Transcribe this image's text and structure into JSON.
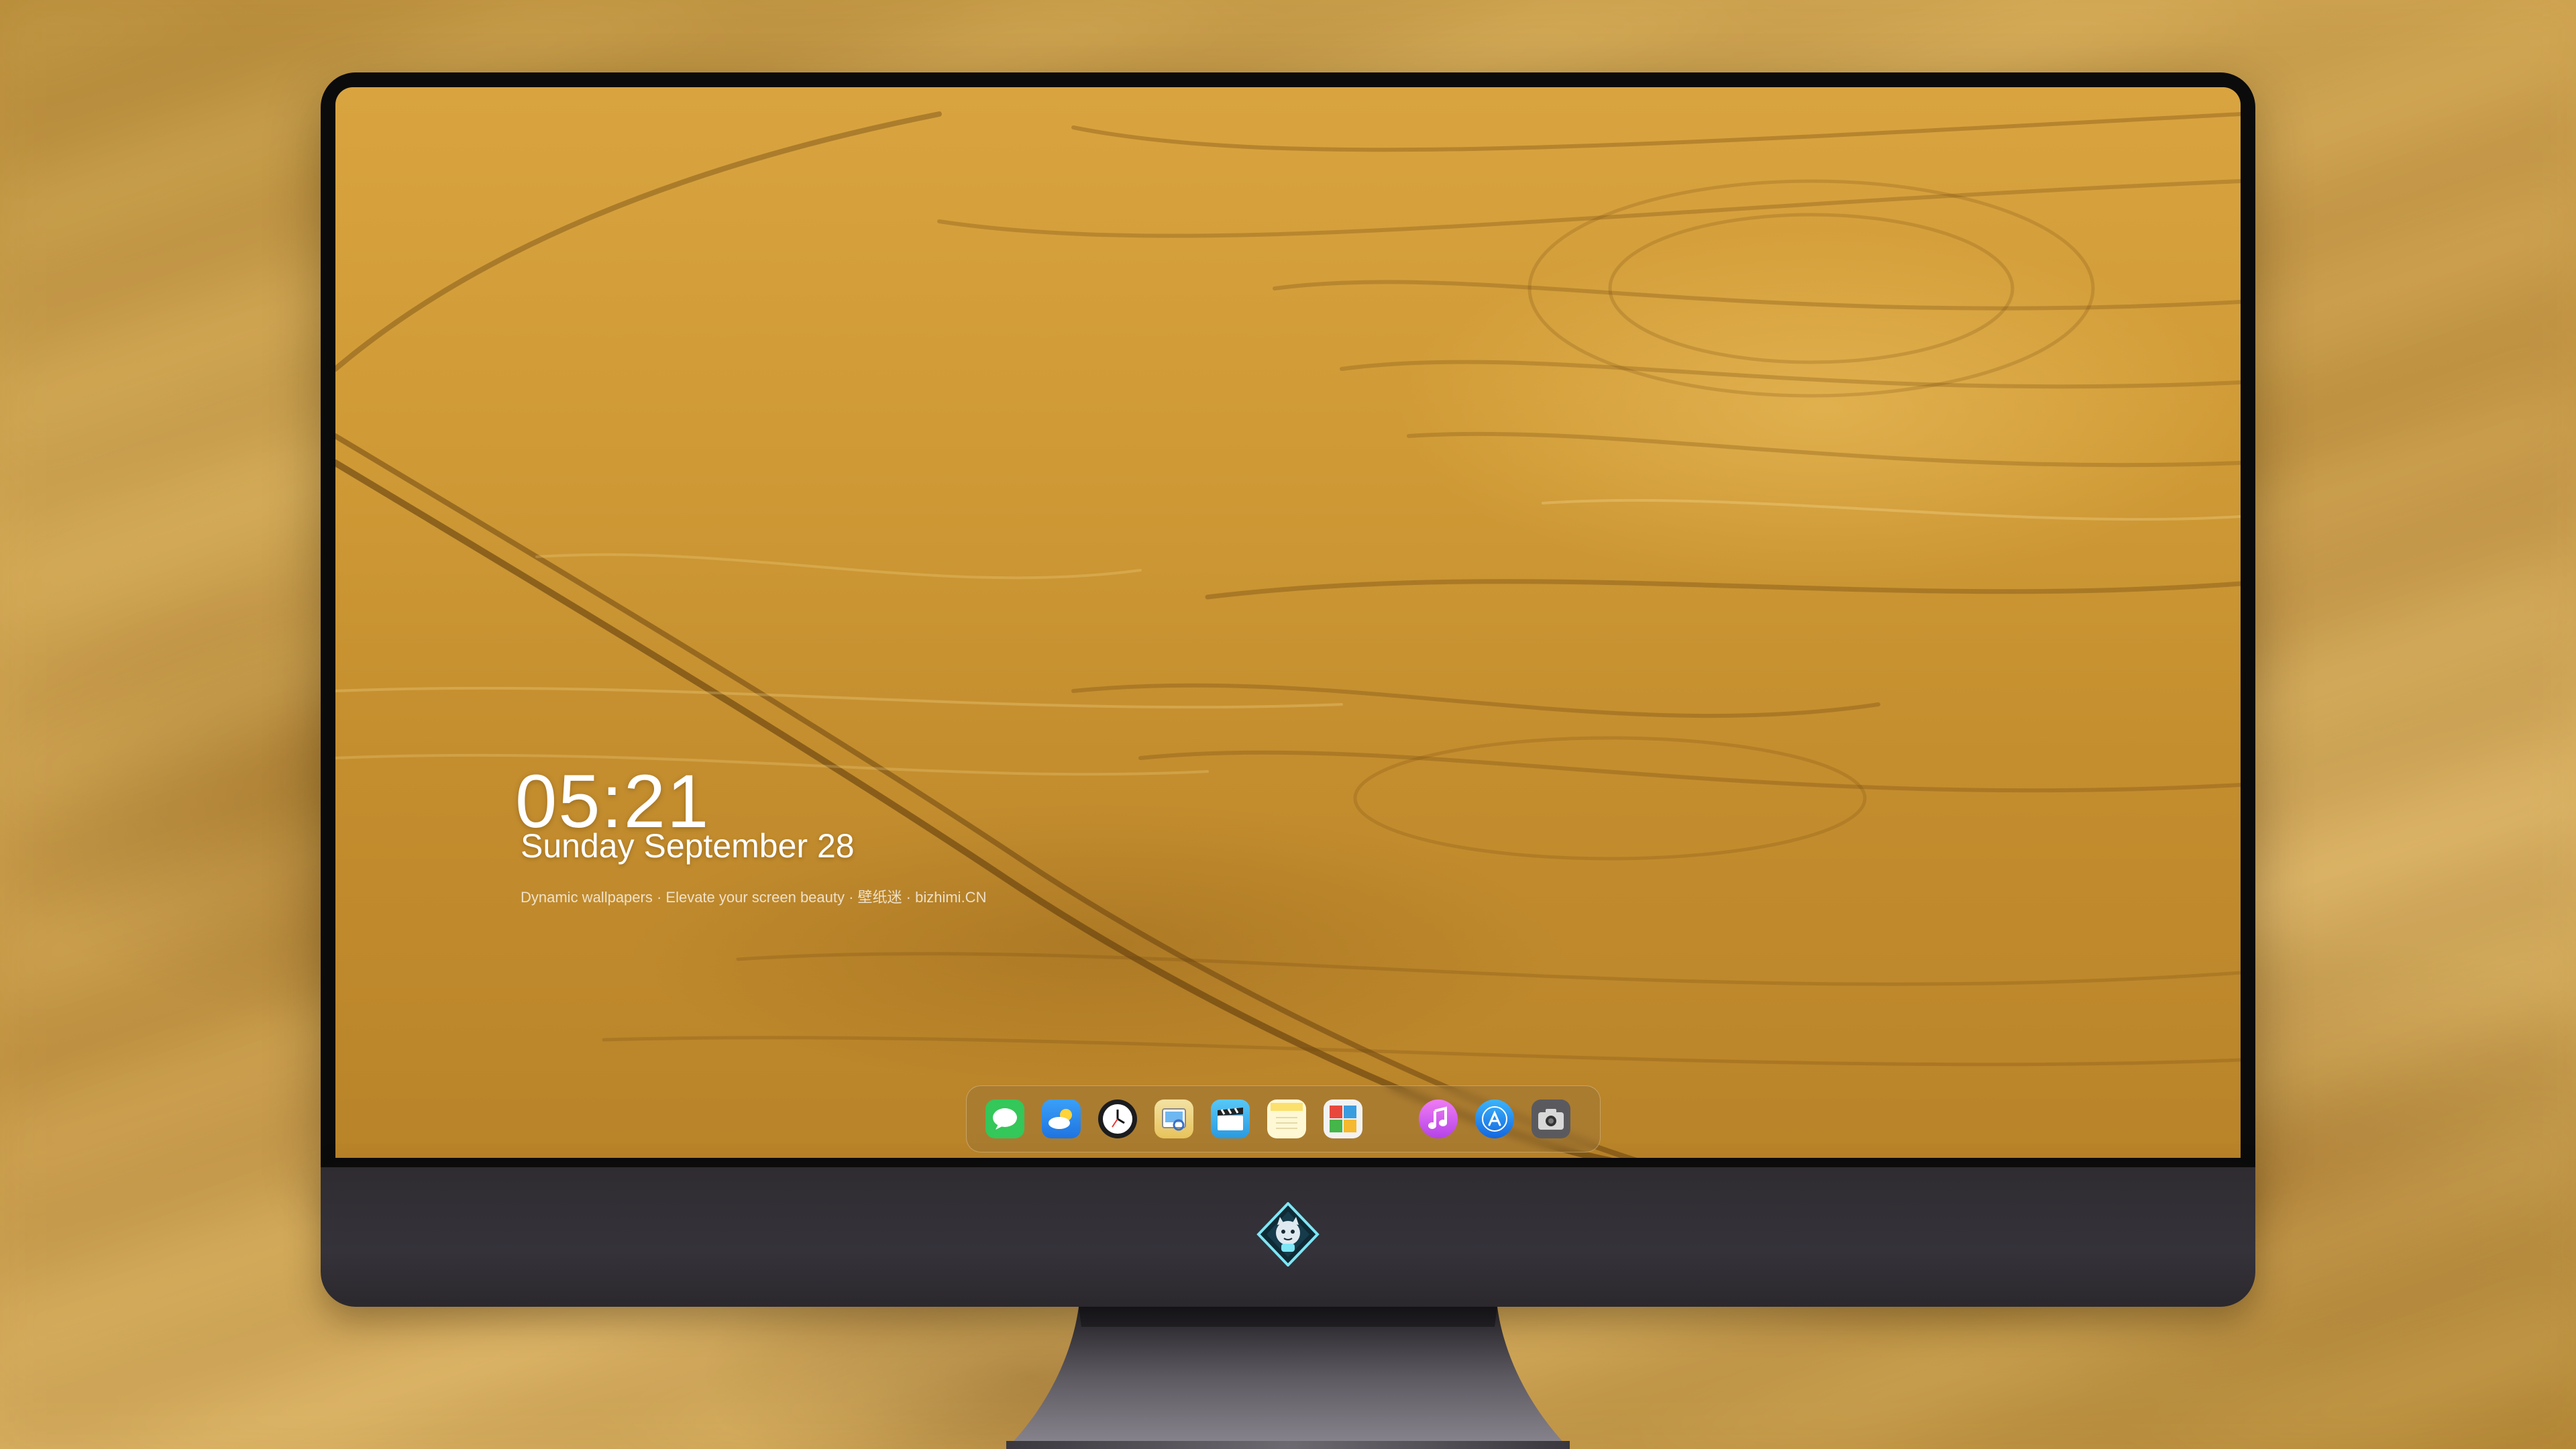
{
  "lock_screen": {
    "time": "05:21",
    "date": "Sunday September  28",
    "caption": "Dynamic wallpapers · Elevate your screen beauty · 壁纸迷 · bizhimi.CN"
  },
  "dock": {
    "items": [
      {
        "name": "Messages",
        "icon": "messages-icon",
        "color": "#34c759"
      },
      {
        "name": "Weather",
        "icon": "weather-icon",
        "color": "#2a8cf0"
      },
      {
        "name": "Clock",
        "icon": "clock-icon",
        "color": "#1c1c1e"
      },
      {
        "name": "Preview",
        "icon": "preview-icon",
        "color": "#e7c35a"
      },
      {
        "name": "Clips",
        "icon": "clapperboard-icon",
        "color": "#3ab0f0"
      },
      {
        "name": "Notes",
        "icon": "notes-icon",
        "color": "#fbe06d"
      },
      {
        "name": "Photo Booth",
        "icon": "photo-booth-icon",
        "color": "#e8483c"
      },
      {
        "name": "iTunes",
        "icon": "music-note-icon",
        "color": "#d44ef0"
      },
      {
        "name": "App Store",
        "icon": "app-store-icon",
        "color": "#1e88f2"
      },
      {
        "name": "Screenshot",
        "icon": "camera-icon",
        "color": "#4a4a4e"
      }
    ]
  },
  "colors": {
    "screen_gold": "#cf9a36",
    "bezel": "#0b0b0c",
    "chin": "#322f34",
    "logo_cyan": "#7ee6f5"
  }
}
